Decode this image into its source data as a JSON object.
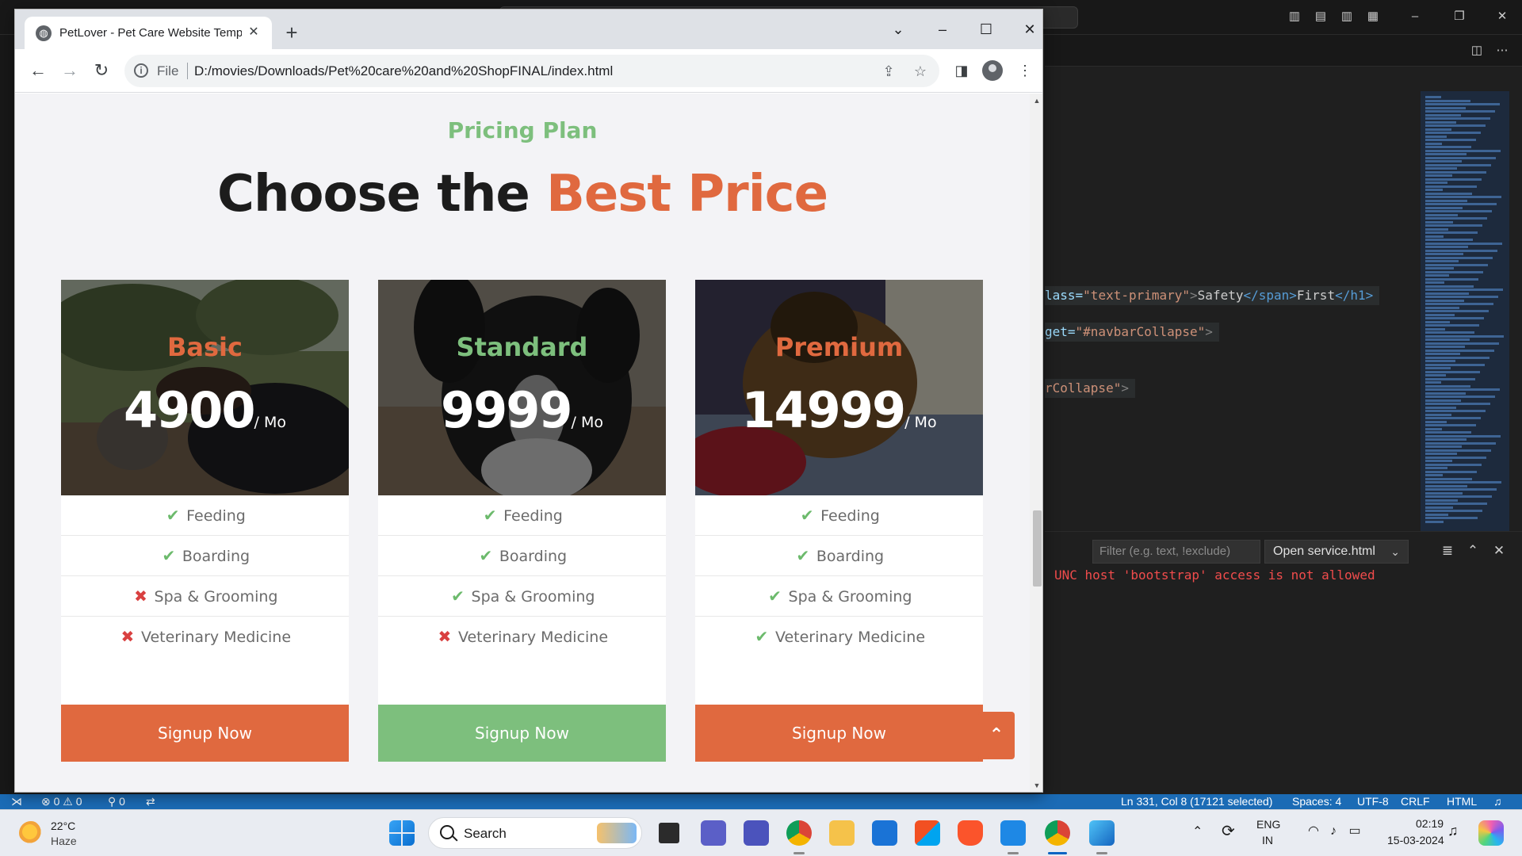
{
  "vscode": {
    "code_lines": [
      {
        "parts": [
          [
            "attr",
            "lass="
          ],
          [
            "str",
            "\"text-primary\""
          ],
          [
            "punc",
            ">"
          ],
          [
            "text",
            "Safety"
          ],
          [
            "tag",
            "</span>"
          ],
          [
            "text",
            "First"
          ],
          [
            "tag",
            "</h1>"
          ]
        ]
      },
      {
        "parts": [
          [
            "attr",
            "get="
          ],
          [
            "str",
            "\"#navbarCollapse\""
          ],
          [
            "punc",
            ">"
          ]
        ]
      },
      {
        "parts": [
          [
            "str",
            "rCollapse\""
          ],
          [
            "punc",
            ">"
          ]
        ]
      }
    ],
    "panel": {
      "filter_placeholder": "Filter (e.g. text, !exclude)",
      "select_value": "Open service.html",
      "error_text": "UNC host 'bootstrap' access is not allowed"
    },
    "status": {
      "problems": "⊗ 0 ⚠ 0",
      "ports": "⚲ 0",
      "cursor": "Ln 331, Col 8 (17121 selected)",
      "spaces": "Spaces: 4",
      "encoding": "UTF-8",
      "eol": "CRLF",
      "language": "HTML"
    }
  },
  "browser": {
    "tab_title": "PetLover - Pet Care Website Template",
    "url_scheme": "File",
    "url": "D:/movies/Downloads/Pet%20care%20and%20ShopFINAL/index.html"
  },
  "page": {
    "eyebrow": "Pricing Plan",
    "headline_prefix": "Choose the ",
    "headline_accent": "Best Price",
    "plans": [
      {
        "name": "Basic",
        "name_color": "#e0693f",
        "price": "4900",
        "period": "/ Mo",
        "features": [
          {
            "label": "Feeding",
            "included": true
          },
          {
            "label": "Boarding",
            "included": true
          },
          {
            "label": "Spa & Grooming",
            "included": false
          },
          {
            "label": "Veterinary Medicine",
            "included": false
          }
        ],
        "button": "Signup Now",
        "button_color": "#e0693f"
      },
      {
        "name": "Standard",
        "name_color": "#7dbf7d",
        "price": "9999",
        "period": "/ Mo",
        "features": [
          {
            "label": "Feeding",
            "included": true
          },
          {
            "label": "Boarding",
            "included": true
          },
          {
            "label": "Spa & Grooming",
            "included": true
          },
          {
            "label": "Veterinary Medicine",
            "included": false
          }
        ],
        "button": "Signup Now",
        "button_color": "#7dbf7d"
      },
      {
        "name": "Premium",
        "name_color": "#e0693f",
        "price": "14999",
        "period": "/ Mo",
        "features": [
          {
            "label": "Feeding",
            "included": true
          },
          {
            "label": "Boarding",
            "included": true
          },
          {
            "label": "Spa & Grooming",
            "included": true
          },
          {
            "label": "Veterinary Medicine",
            "included": true
          }
        ],
        "button": "Signup Now",
        "button_color": "#e0693f"
      }
    ]
  },
  "taskbar": {
    "weather_temp": "22°C",
    "weather_cond": "Haze",
    "search_label": "Search",
    "lang_line1": "ENG",
    "lang_line2": "IN",
    "time": "02:19",
    "date": "15-03-2024",
    "apps": [
      "task-view",
      "teams",
      "teams-work",
      "chrome",
      "file-explorer",
      "mail",
      "store",
      "brave",
      "vscode",
      "chrome-active",
      "photos"
    ]
  },
  "colors": {
    "accent_orange": "#e0693f",
    "accent_green": "#7dbf7d",
    "vscode_status": "#1b6bb5"
  }
}
